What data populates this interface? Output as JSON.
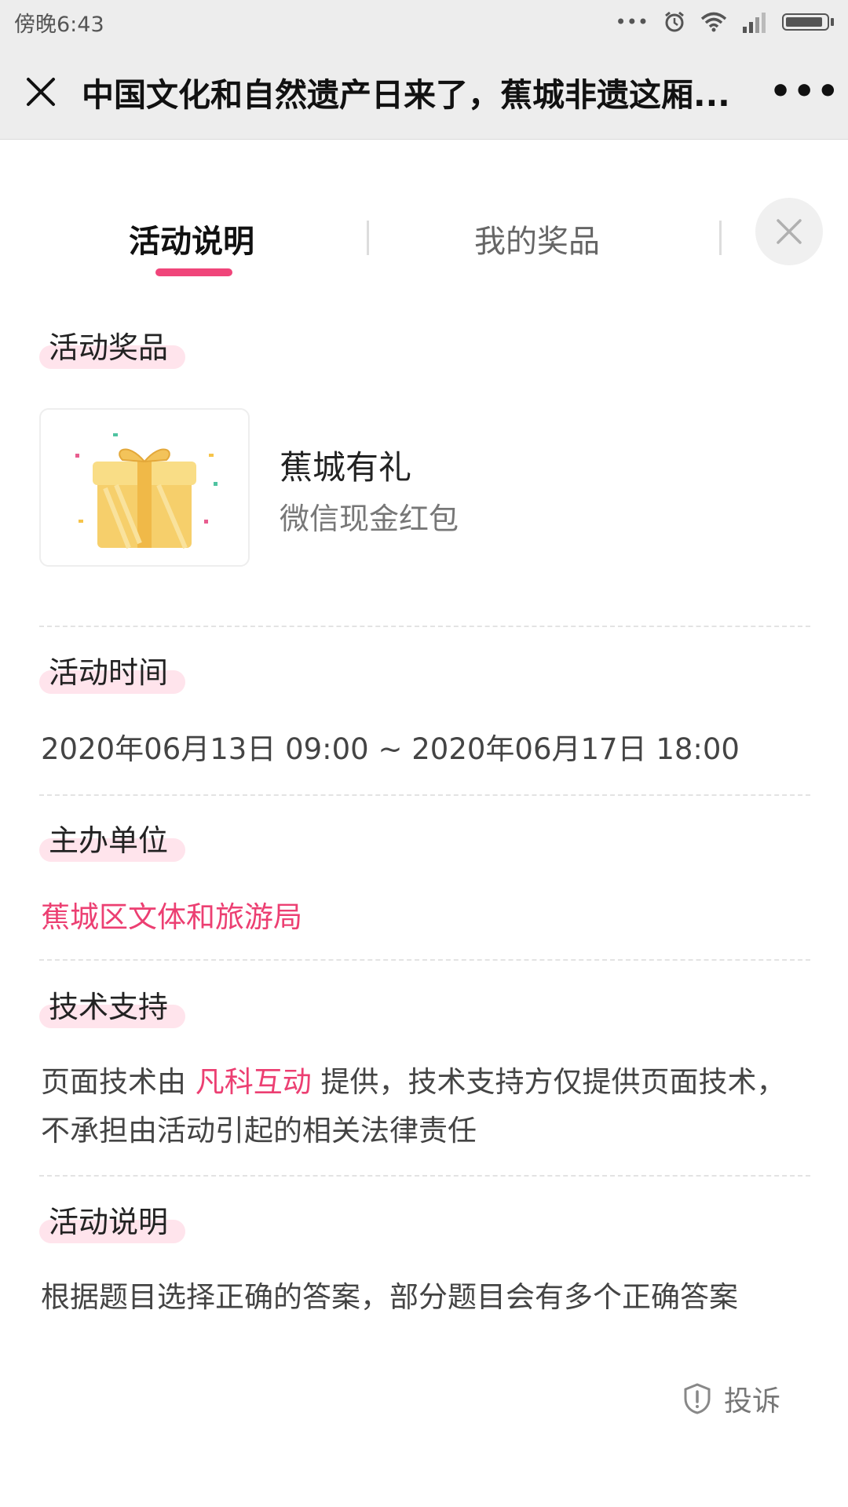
{
  "status_bar": {
    "time": "傍晚6:43",
    "dots": "•••"
  },
  "nav": {
    "title": "中国文化和自然遗产日来了，蕉城非遗这厢...",
    "more": "•••"
  },
  "tabs": {
    "activity": "活动说明",
    "prizes": "我的奖品"
  },
  "sections": {
    "prize": {
      "label": "活动奖品",
      "name": "蕉城有礼",
      "desc": "微信现金红包"
    },
    "time": {
      "label": "活动时间",
      "value": "2020年06月13日 09:00 ~ 2020年06月17日 18:00"
    },
    "organizer": {
      "label": "主办单位",
      "value": "蕉城区文体和旅游局"
    },
    "tech": {
      "label": "技术支持",
      "prefix": "页面技术由 ",
      "company": "凡科互动",
      "suffix": " 提供，技术支持方仅提供页面技术，不承担由活动引起的相关法律责任"
    },
    "desc": {
      "label": "活动说明",
      "text": "根据题目选择正确的答案，部分题目会有多个正确答案"
    }
  },
  "report": {
    "label": "投诉"
  },
  "colors": {
    "accent": "#f0457a",
    "link": "#ec3f72",
    "bar_bg": "#ededed"
  }
}
